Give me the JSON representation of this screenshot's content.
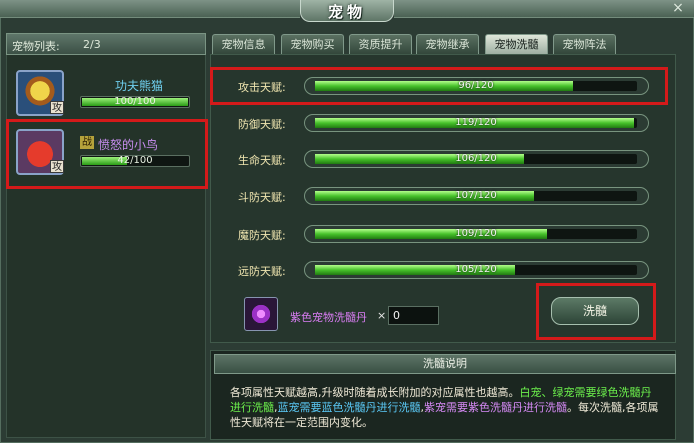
{
  "window": {
    "title": "宠物",
    "close": "×"
  },
  "tabs": [
    {
      "label": "宠物信息",
      "active": false
    },
    {
      "label": "宠物购买",
      "active": false
    },
    {
      "label": "资质提升",
      "active": false
    },
    {
      "label": "宠物继承",
      "active": false
    },
    {
      "label": "宠物洗髓",
      "active": true
    },
    {
      "label": "宠物阵法",
      "active": false
    }
  ],
  "pet_list": {
    "label": "宠物列表:",
    "count": "2/3",
    "pets": [
      {
        "name": "功夫熊猫",
        "role": "攻",
        "exp_text": "100/100",
        "exp_fraction": 1.0,
        "selected": false
      },
      {
        "name": "愤怒的小鸟",
        "role": "攻",
        "fight": "战",
        "exp_text": "42/100",
        "exp_fraction": 0.42,
        "selected": true
      }
    ]
  },
  "talents": [
    {
      "label": "攻击天赋:",
      "value_text": "96/120",
      "fraction": 0.8
    },
    {
      "label": "防御天赋:",
      "value_text": "119/120",
      "fraction": 0.99
    },
    {
      "label": "生命天赋:",
      "value_text": "106/120",
      "fraction": 0.65
    },
    {
      "label": "斗防天赋:",
      "value_text": "107/120",
      "fraction": 0.68
    },
    {
      "label": "魔防天赋:",
      "value_text": "109/120",
      "fraction": 0.72
    },
    {
      "label": "远防天赋:",
      "value_text": "105/120",
      "fraction": 0.62
    }
  ],
  "item": {
    "icon": "purple-gem-icon",
    "name": "紫色宠物洗髓丹",
    "times": "×",
    "quantity": "0"
  },
  "wash_button": "洗髓",
  "description": {
    "title": "洗髓说明",
    "seg1": "各项属性天赋越高,升级时随着成长附加的对应属性也越高。",
    "seg2": "白宠、绿宠需要绿色洗髓丹进行洗髓",
    "seg3": ",",
    "seg4": "蓝宠需要蓝色洗髓丹进行洗髓",
    "seg5": ",",
    "seg6": "紫宠需要紫色洗髓丹进行洗髓",
    "seg7": "。每次洗髓,各项属性天赋将在一定范围内变化。"
  },
  "colors": {
    "highlight": "#d41a1a",
    "bar_fill": "#47c22b",
    "accent_text": "#f0e6b0"
  }
}
